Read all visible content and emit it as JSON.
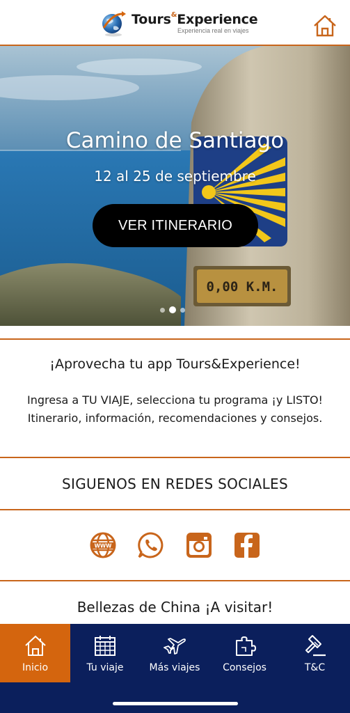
{
  "header": {
    "logo_title": "Tours",
    "logo_amp": "&",
    "logo_title2": "Experience",
    "logo_subtitle": "Experiencia real en viajes",
    "home_icon": "home-icon"
  },
  "hero": {
    "title": "Camino de Santiago",
    "dates": "12 al 25 de septiembre",
    "button_label": "VER ITINERARIO",
    "milestone_text": "0,00 K.M.",
    "carousel": {
      "count": 3,
      "active_index": 1
    }
  },
  "promo": {
    "title": "¡Aprovecha tu app Tours&Experience!",
    "body": "Ingresa a TU VIAJE, selecciona tu programa ¡y LISTO! Itinerario, información, recomendaciones y consejos."
  },
  "social": {
    "title": "SIGUENOS EN REDES SOCIALES",
    "icons": [
      "www-globe-icon",
      "whatsapp-icon",
      "instagram-icon",
      "facebook-icon"
    ]
  },
  "next_section": {
    "title": "Bellezas de China ¡A visitar!"
  },
  "bottom_nav": {
    "items": [
      {
        "label": "Inicio",
        "icon": "home-icon",
        "active": true
      },
      {
        "label": "Tu viaje",
        "icon": "calendar-icon",
        "active": false
      },
      {
        "label": "Más viajes",
        "icon": "airplane-icon",
        "active": false
      },
      {
        "label": "Consejos",
        "icon": "puzzle-icon",
        "active": false
      },
      {
        "label": "T&C",
        "icon": "gavel-icon",
        "active": false
      }
    ]
  },
  "colors": {
    "accent": "#c8651b",
    "nav_background": "#0b1f5c",
    "nav_active": "#d4650e"
  }
}
